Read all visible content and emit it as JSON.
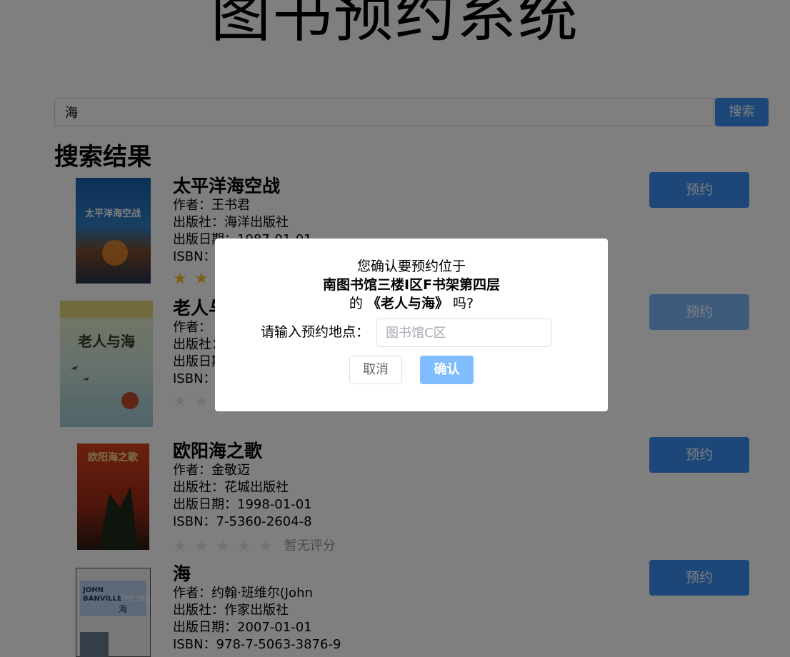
{
  "app": {
    "title": "图书预约系统"
  },
  "search": {
    "value": "海",
    "button_label": "搜索"
  },
  "results": {
    "heading": "搜索结果",
    "books": [
      {
        "title": "太平洋海空战",
        "author": "作者：王书君",
        "publisher": "出版社：海洋出版社",
        "publish_date": "出版日期：1987-01-01",
        "isbn": "ISBN：",
        "rating_stars": 2,
        "rating_text": "",
        "reserve_label": "预约",
        "cover_text": "太平洋海空战"
      },
      {
        "title": "老人与海",
        "author": "作者：",
        "publisher": "出版社：",
        "publish_date": "出版日期：",
        "isbn": "ISBN：",
        "rating_stars": 0,
        "rating_text": "",
        "reserve_label": "预约",
        "cover_text": "老人与海"
      },
      {
        "title": "欧阳海之歌",
        "author": "作者：金敬迈",
        "publisher": "出版社：花城出版社",
        "publish_date": "出版日期：1998-01-01",
        "isbn": "ISBN：7-5360-2604-8",
        "rating_stars": 0,
        "rating_text": "暂无评分",
        "reserve_label": "预约",
        "cover_text": "欧阳海之歌"
      },
      {
        "title": "海",
        "author": "作者：约翰·班维尔(John",
        "publisher": "出版社：作家出版社",
        "publish_date": "出版日期：2007-01-01",
        "isbn": "ISBN：978-7-5063-3876-9",
        "rating_stars": 0,
        "rating_text": "",
        "reserve_label": "预约",
        "cover_text": "JOHN BANVILLE THE SEA 海"
      }
    ]
  },
  "dialog": {
    "line1": "您确认要预约位于",
    "location": "南图书馆三楼I区F书架第四层",
    "line3_prefix": "的",
    "book_title": "《老人与海》",
    "line3_suffix": "吗?",
    "input_label": "请输入预约地点：",
    "input_placeholder": "图书馆C区",
    "cancel_label": "取消",
    "confirm_label": "确认"
  },
  "colors": {
    "primary": "#3b8ef0",
    "primary_light": "#80bdff",
    "star_on": "#f7ba2a",
    "star_off": "#e6e6e6",
    "overlay": "rgba(0,0,0,0.5)"
  }
}
